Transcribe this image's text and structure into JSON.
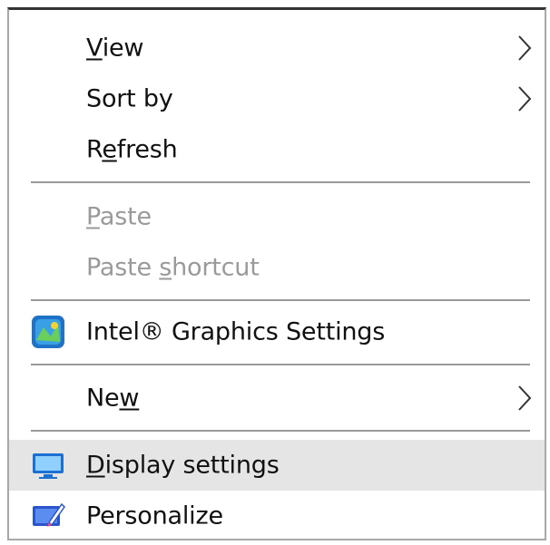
{
  "menu": {
    "items": [
      {
        "id": "view",
        "before": "",
        "accel": "V",
        "after": "iew",
        "submenu": true,
        "disabled": false
      },
      {
        "id": "sort-by",
        "before": "",
        "accel": "",
        "after": "Sort by",
        "submenu": true,
        "disabled": false
      },
      {
        "id": "refresh",
        "before": "R",
        "accel": "e",
        "after": "fresh",
        "submenu": false,
        "disabled": false
      },
      {
        "id": "paste",
        "before": "",
        "accel": "P",
        "after": "aste",
        "submenu": false,
        "disabled": true
      },
      {
        "id": "paste-shortcut",
        "before": "Paste ",
        "accel": "s",
        "after": "hortcut",
        "submenu": false,
        "disabled": true
      },
      {
        "id": "intel-graphics",
        "before": "",
        "accel": "",
        "after": "Intel® Graphics Settings",
        "submenu": false,
        "disabled": false,
        "icon": "intel-graphics-icon"
      },
      {
        "id": "new",
        "before": "Ne",
        "accel": "w",
        "after": "",
        "submenu": true,
        "disabled": false
      },
      {
        "id": "display-settings",
        "before": "",
        "accel": "D",
        "after": "isplay settings",
        "submenu": false,
        "disabled": false,
        "icon": "display-icon",
        "highlighted": true
      },
      {
        "id": "personalize",
        "before": "",
        "accel": "",
        "after": "Personalize",
        "submenu": false,
        "disabled": false,
        "icon": "personalize-icon"
      }
    ]
  },
  "colors": {
    "text": "#111111",
    "disabled_text": "#9a9a9a",
    "highlight": "#e5e5e5",
    "separator": "#9a9a9a"
  }
}
